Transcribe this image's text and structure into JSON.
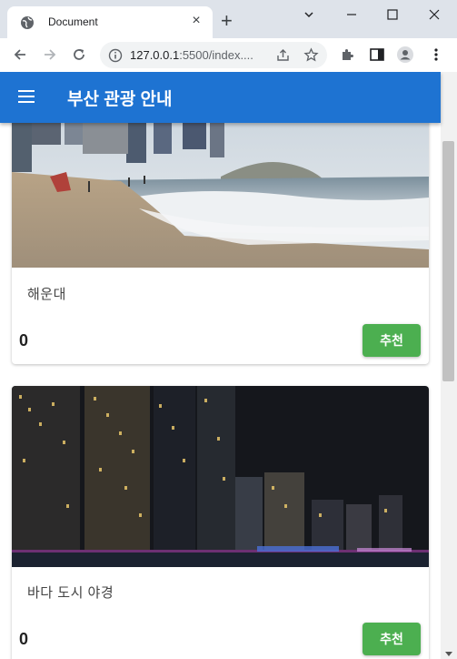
{
  "browser": {
    "tab_title": "Document",
    "url_host": "127.0.0.1",
    "url_rest": ":5500/index....",
    "new_tab_symbol": "+",
    "close_symbol": "×"
  },
  "app": {
    "title": "부산 관광 안내"
  },
  "cards": [
    {
      "title": "해운대",
      "count": "0",
      "button": "추천"
    },
    {
      "title": "바다 도시 야경",
      "count": "0",
      "button": "추천"
    }
  ],
  "colors": {
    "appbar": "#1e73d2",
    "button": "#4caf50"
  }
}
